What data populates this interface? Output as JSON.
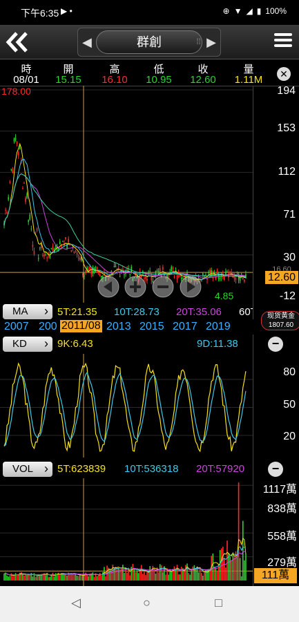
{
  "status": {
    "time": "下午6:35",
    "battery": "100%"
  },
  "header": {
    "title": "群創"
  },
  "quote": {
    "labels": [
      "時",
      "開",
      "高",
      "低",
      "收",
      "量"
    ],
    "values": [
      "08/01",
      "15.15",
      "16.10",
      "10.95",
      "12.60",
      "1.11M"
    ]
  },
  "price_axis": {
    "labels": [
      "194",
      "153",
      "112",
      "71",
      "30",
      "-12"
    ],
    "max_label": "178.00",
    "current": "12.60",
    "current_hidden": "16.60",
    "min_label": "4.85"
  },
  "ma": {
    "button": "MA",
    "t5": "5T:21.35",
    "t10": "10T:28.73",
    "t20": "20T:35.06",
    "t60": "60T"
  },
  "years": {
    "labels": [
      "2007",
      "200",
      "2011/08",
      "2013",
      "2015",
      "2017",
      "2019"
    ]
  },
  "gold": {
    "line1": "现货黄金",
    "line2": "1807.60"
  },
  "kd": {
    "button": "KD",
    "k": "9K:6.43",
    "d": "9D:11.38",
    "axis": [
      "80",
      "50",
      "20"
    ]
  },
  "vol": {
    "button": "VOL",
    "t5": "5T:623839",
    "t10": "10T:536318",
    "t20": "20T:57920",
    "axis": [
      "1117萬",
      "838萬",
      "558萬",
      "279萬"
    ],
    "current": "111萬"
  },
  "colors": {
    "yellow": "#f5e21a",
    "cyan": "#40c8e8",
    "magenta": "#cc44dd",
    "red": "#ff2b2b",
    "green": "#2bd42b"
  },
  "chart_data": {
    "type": "line",
    "title": "",
    "price_ylim": [
      -12,
      194
    ],
    "kd_ticks": [
      20,
      50,
      80
    ],
    "vol_ticks_wan": [
      279,
      558,
      838,
      1117
    ]
  }
}
